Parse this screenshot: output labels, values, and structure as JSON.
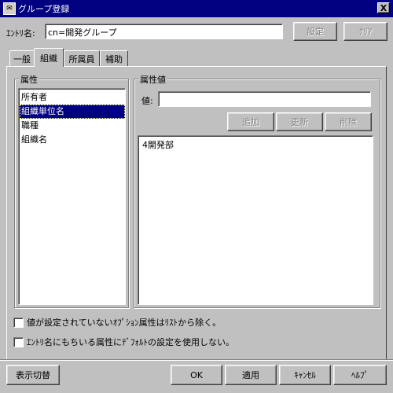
{
  "window": {
    "title": "グループ登録",
    "close_label": "X"
  },
  "entry": {
    "label": "ｴﾝﾄﾘ名:",
    "value": "cn=開発グループ",
    "set_button": "設定",
    "clear_button": "ｸﾘｱ"
  },
  "tabs": [
    {
      "label": "一般",
      "active": false
    },
    {
      "label": "組織",
      "active": true
    },
    {
      "label": "所属員",
      "active": false
    },
    {
      "label": "補助",
      "active": false
    }
  ],
  "attributes": {
    "group_label": "属性",
    "items": [
      "所有者",
      "組織単位名",
      "職種",
      "組織名"
    ],
    "selected_index": 1
  },
  "values": {
    "group_label": "属性値",
    "value_label": "値:",
    "value_input": "",
    "add_button": "追加",
    "update_button": "更新",
    "delete_button": "削除",
    "items": [
      "4開発部"
    ]
  },
  "options": {
    "exclude_unset_optional": "値が設定されていないｵﾌﾟｼｮﾝ属性はﾘｽﾄから除く。",
    "no_default_settings": "ｴﾝﾄﾘ名にもちいる属性にﾃﾞﾌｫﾙﾄの設定を使用しない。"
  },
  "footer": {
    "toggle_view": "表示切替",
    "ok": "OK",
    "apply": "適用",
    "cancel": "ｷｬﾝｾﾙ",
    "help": "ﾍﾙﾌﾟ"
  }
}
